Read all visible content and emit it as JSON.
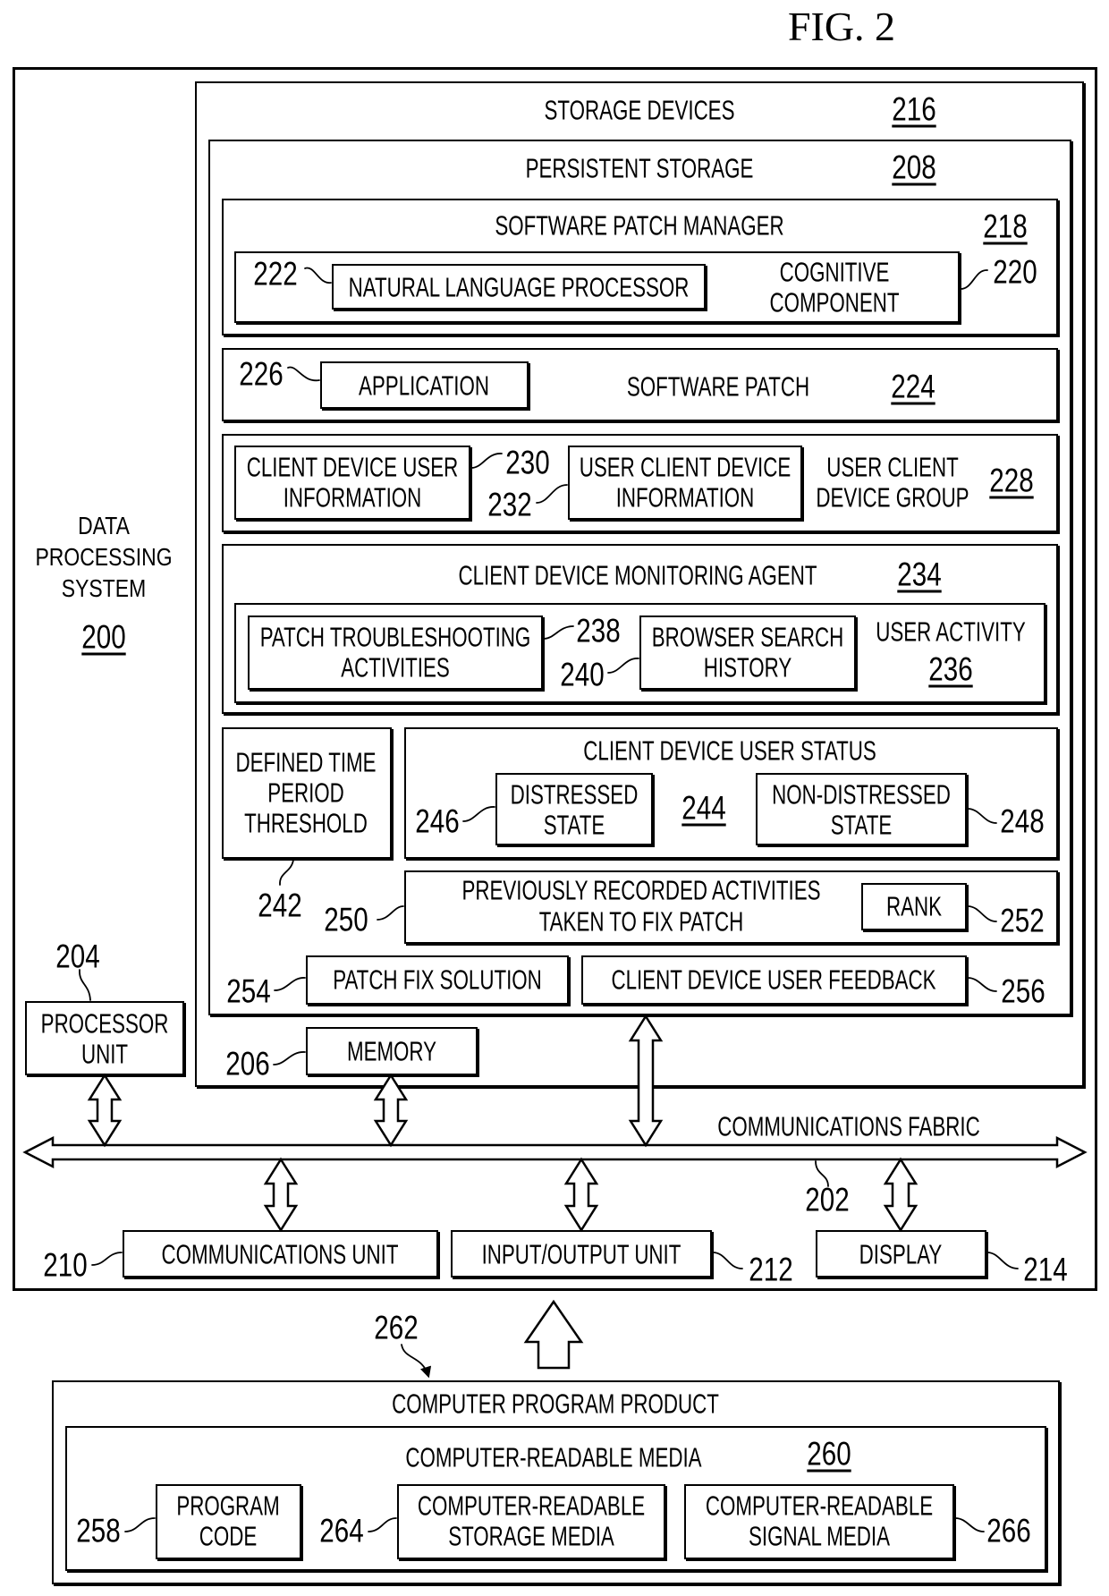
{
  "figure": {
    "title": "FIG. 2"
  },
  "data_processing_system": {
    "label_lines": [
      "DATA",
      "PROCESSING",
      "SYSTEM"
    ],
    "ref": "200"
  },
  "storage_devices": {
    "label": "STORAGE DEVICES",
    "ref": "216"
  },
  "persistent_storage": {
    "label": "PERSISTENT STORAGE",
    "ref": "208"
  },
  "software_patch_manager": {
    "label": "SOFTWARE PATCH MANAGER",
    "ref": "218",
    "cognitive_component": {
      "label_lines": [
        "COGNITIVE",
        "COMPONENT"
      ],
      "ref": "220"
    },
    "natural_language_processor": {
      "label": "NATURAL LANGUAGE PROCESSOR",
      "ref": "222"
    }
  },
  "software_patch": {
    "label": "SOFTWARE PATCH",
    "ref": "224",
    "application": {
      "label": "APPLICATION",
      "ref": "226"
    }
  },
  "user_client_device_group": {
    "label_lines": [
      "USER CLIENT",
      "DEVICE GROUP"
    ],
    "ref": "228",
    "client_device_user_information": {
      "label_lines": [
        "CLIENT DEVICE USER",
        "INFORMATION"
      ],
      "ref": "230"
    },
    "user_client_device_information": {
      "label_lines": [
        "USER CLIENT DEVICE",
        "INFORMATION"
      ],
      "ref": "232"
    }
  },
  "client_device_monitoring_agent": {
    "label": "CLIENT DEVICE MONITORING AGENT",
    "ref": "234",
    "user_activity": {
      "label": "USER ACTIVITY",
      "ref": "236",
      "patch_troubleshooting_activities": {
        "label_lines": [
          "PATCH TROUBLESHOOTING",
          "ACTIVITIES"
        ],
        "ref": "238"
      },
      "browser_search_history": {
        "label_lines": [
          "BROWSER SEARCH",
          "HISTORY"
        ],
        "ref": "240"
      }
    }
  },
  "defined_time_period_threshold": {
    "label_lines": [
      "DEFINED TIME",
      "PERIOD",
      "THRESHOLD"
    ],
    "ref": "242"
  },
  "client_device_user_status": {
    "label": "CLIENT DEVICE USER STATUS",
    "ref": "244",
    "distressed_state": {
      "label_lines": [
        "DISTRESSED",
        "STATE"
      ],
      "ref": "246"
    },
    "non_distressed_state": {
      "label_lines": [
        "NON-DISTRESSED",
        "STATE"
      ],
      "ref": "248"
    }
  },
  "previously_recorded_activities": {
    "label_lines": [
      "PREVIOUSLY RECORDED ACTIVITIES",
      "TAKEN TO FIX PATCH"
    ],
    "ref": "250",
    "rank": {
      "label": "RANK",
      "ref": "252"
    }
  },
  "patch_fix_solution": {
    "label": "PATCH FIX SOLUTION",
    "ref": "254"
  },
  "client_device_user_feedback": {
    "label": "CLIENT DEVICE USER FEEDBACK",
    "ref": "256"
  },
  "processor_unit": {
    "label_lines": [
      "PROCESSOR",
      "UNIT"
    ],
    "ref": "204"
  },
  "memory": {
    "label": "MEMORY",
    "ref": "206"
  },
  "communications_fabric": {
    "label": "COMMUNICATIONS FABRIC",
    "ref": "202"
  },
  "communications_unit": {
    "label": "COMMUNICATIONS UNIT",
    "ref": "210"
  },
  "input_output_unit": {
    "label": "INPUT/OUTPUT UNIT",
    "ref": "212"
  },
  "display": {
    "label": "DISPLAY",
    "ref": "214"
  },
  "computer_program_product": {
    "label": "COMPUTER PROGRAM PRODUCT",
    "ref": "262",
    "computer_readable_media": {
      "label": "COMPUTER-READABLE MEDIA",
      "ref": "260",
      "program_code": {
        "label_lines": [
          "PROGRAM",
          "CODE"
        ],
        "ref": "258"
      },
      "storage_media": {
        "label_lines": [
          "COMPUTER-READABLE",
          "STORAGE MEDIA"
        ],
        "ref": "264"
      },
      "signal_media": {
        "label_lines": [
          "COMPUTER-READABLE",
          "SIGNAL MEDIA"
        ],
        "ref": "266"
      }
    }
  }
}
